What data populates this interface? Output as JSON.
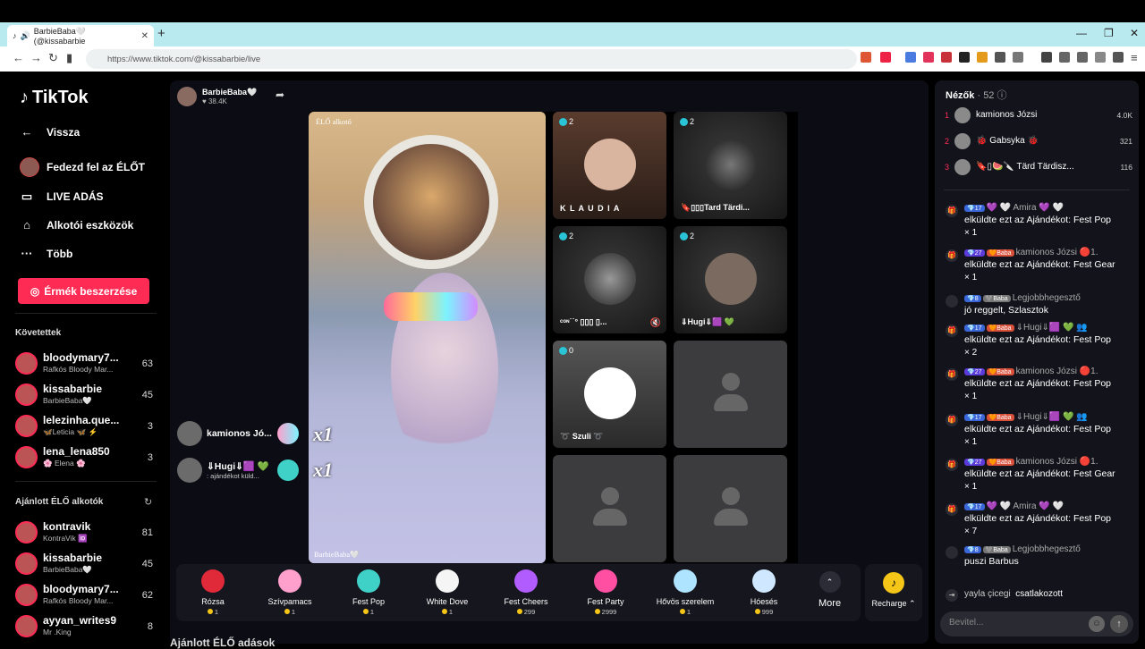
{
  "browser": {
    "tab_title": "BarbieBaba🤍 (@kissabarbie",
    "url": "https://www.tiktok.com/@kissabarbie/live"
  },
  "sidebar": {
    "brand": "TikTok",
    "nav": [
      {
        "label": "Vissza",
        "icon": "arrow-left-icon"
      },
      {
        "label": "Fedezd fel az ÉLŐT",
        "icon": "avatar"
      },
      {
        "label": "LIVE ADÁS",
        "icon": "live-icon"
      },
      {
        "label": "Alkotói eszközök",
        "icon": "home-icon"
      },
      {
        "label": "Több",
        "icon": "ellipsis-icon"
      }
    ],
    "coins_button": "Érmék beszerzése",
    "following_title": "Követettek",
    "following": [
      {
        "name": "bloodymary7...",
        "sub": "Rafkós Bloody Mar...",
        "count": "63"
      },
      {
        "name": "kissabarbie",
        "sub": "BarbieBaba🤍",
        "count": "45"
      },
      {
        "name": "lelezinha.que...",
        "sub": "🦋Leticia 🦋 ⚡",
        "count": "3"
      },
      {
        "name": "lena_lena850",
        "sub": "🌸 Elena 🌸",
        "count": "3"
      }
    ],
    "recommended_title": "Ajánlott ÉLŐ alkotók",
    "recommended": [
      {
        "name": "kontravik",
        "sub": "KontraVik 🆔",
        "count": "81"
      },
      {
        "name": "kissabarbie",
        "sub": "BarbieBaba🤍",
        "count": "45"
      },
      {
        "name": "bloodymary7...",
        "sub": "Rafkós Bloody Mar...",
        "count": "62"
      },
      {
        "name": "ayyan_writes9",
        "sub": "Mr .King",
        "count": "8"
      }
    ]
  },
  "stream": {
    "host_name": "BarbieBaba🤍",
    "host_likes": "♥ 38.4K",
    "live_tag": "ÉLŐ alkotó",
    "host_caption": "BarbieBaba🤍",
    "multipliers": [
      "x1",
      "x1"
    ],
    "guests": [
      {
        "count": "2",
        "name": "K L A U D I A",
        "color": "#d9b5a0"
      },
      {
        "count": "2",
        "name": "🔖▯▯▯Tard Tärdi...",
        "color": "#222"
      },
      {
        "count": "2",
        "name": "ᶜᵒᶰ˙˙° ▯▯▯ ▯...",
        "color": "#555"
      },
      {
        "count": "2",
        "name": "⇓Hugi⇓🟪 💚",
        "color": "#7a6a5f"
      },
      {
        "count": "0",
        "name": "➰ Szuli ➰",
        "color": "#445"
      }
    ],
    "gift_events": [
      {
        "name": "kamionos Jó...",
        "sub": ""
      },
      {
        "name": "⇓Hugi⇓🟪 💚",
        "sub": ": ajándékot küld..."
      }
    ]
  },
  "gifts": [
    {
      "name": "Rózsa",
      "price": "1",
      "color": "#e02a3a"
    },
    {
      "name": "Szívpamacs",
      "price": "1",
      "color": "#ff9fcb"
    },
    {
      "name": "Fest Pop",
      "price": "1",
      "color": "#3fd1c8"
    },
    {
      "name": "White Dove",
      "price": "1",
      "color": "#f5f5f5"
    },
    {
      "name": "Fest Cheers",
      "price": "299",
      "color": "#b05cff"
    },
    {
      "name": "Fest Party",
      "price": "2999",
      "color": "#ff4fa3"
    },
    {
      "name": "Hővös szerelem",
      "price": "1",
      "color": "#aee4ff"
    },
    {
      "name": "Hóesés",
      "price": "999",
      "color": "#cfe8ff"
    }
  ],
  "gift_more": "More",
  "recharge": "Recharge ⌃",
  "bottom_title": "Ajánlott ÉLŐ adások",
  "chat": {
    "viewers_label": "Nézők",
    "viewers_count": "· 52",
    "top_viewers": [
      {
        "rank": "1",
        "name": "kamionos Józsi",
        "score": "4.0K"
      },
      {
        "rank": "2",
        "name": "🐞 Gabsyka 🐞",
        "score": "321"
      },
      {
        "rank": "3",
        "name": "🔖▯🍉🔪 Tärd Tärdisz...",
        "score": "116"
      }
    ],
    "messages": [
      {
        "badges": [
          {
            "t": "💎17",
            "c": "#3a66d8"
          }
        ],
        "user": "💜 🤍 Amira 💜 🤍",
        "text": "elküldte ezt az Ajándékot: Fest Pop",
        "count": "× 1"
      },
      {
        "badges": [
          {
            "t": "💎27",
            "c": "#5a3ad8"
          },
          {
            "t": "🧡Baba",
            "c": "#d8503a"
          }
        ],
        "user": "kamionos Józsi 🔴1.",
        "text": "elküldte ezt az Ajándékot: Fest Gear",
        "count": "× 1"
      },
      {
        "badges": [
          {
            "t": "💎8",
            "c": "#3a66d8"
          },
          {
            "t": "🩶Baba",
            "c": "#777"
          }
        ],
        "user": "Legjobbhegesztő",
        "text": "jó reggelt, Szlasztok",
        "count": ""
      },
      {
        "badges": [
          {
            "t": "💎17",
            "c": "#3a66d8"
          },
          {
            "t": "🧡Baba",
            "c": "#d8503a"
          }
        ],
        "user": "⇓Hugi⇓🟪 💚 👥",
        "text": "elküldte ezt az Ajándékot: Fest Pop",
        "count": "× 2"
      },
      {
        "badges": [
          {
            "t": "💎27",
            "c": "#5a3ad8"
          },
          {
            "t": "🧡Baba",
            "c": "#d8503a"
          }
        ],
        "user": "kamionos Józsi 🔴1.",
        "text": "elküldte ezt az Ajándékot: Fest Pop",
        "count": "× 1"
      },
      {
        "badges": [
          {
            "t": "💎17",
            "c": "#3a66d8"
          },
          {
            "t": "🧡Baba",
            "c": "#d8503a"
          }
        ],
        "user": "⇓Hugi⇓🟪 💚 👥",
        "text": "elküldte ezt az Ajándékot: Fest Pop",
        "count": "× 1"
      },
      {
        "badges": [
          {
            "t": "💎27",
            "c": "#5a3ad8"
          },
          {
            "t": "🧡Baba",
            "c": "#d8503a"
          }
        ],
        "user": "kamionos Józsi 🔴1.",
        "text": "elküldte ezt az Ajándékot: Fest Gear",
        "count": "× 1"
      },
      {
        "badges": [
          {
            "t": "💎17",
            "c": "#3a66d8"
          }
        ],
        "user": "💜 🤍 Amira 💜 🤍",
        "text": "elküldte ezt az Ajándékot: Fest Pop",
        "count": "× 7"
      },
      {
        "badges": [
          {
            "t": "💎8",
            "c": "#3a66d8"
          },
          {
            "t": "🩶Baba",
            "c": "#777"
          }
        ],
        "user": "Legjobbhegesztő",
        "text": "puszi Barbus",
        "count": ""
      }
    ],
    "join": {
      "user": "yayla çicegi",
      "text": "csatlakozott"
    },
    "input_placeholder": "Bevitel..."
  }
}
